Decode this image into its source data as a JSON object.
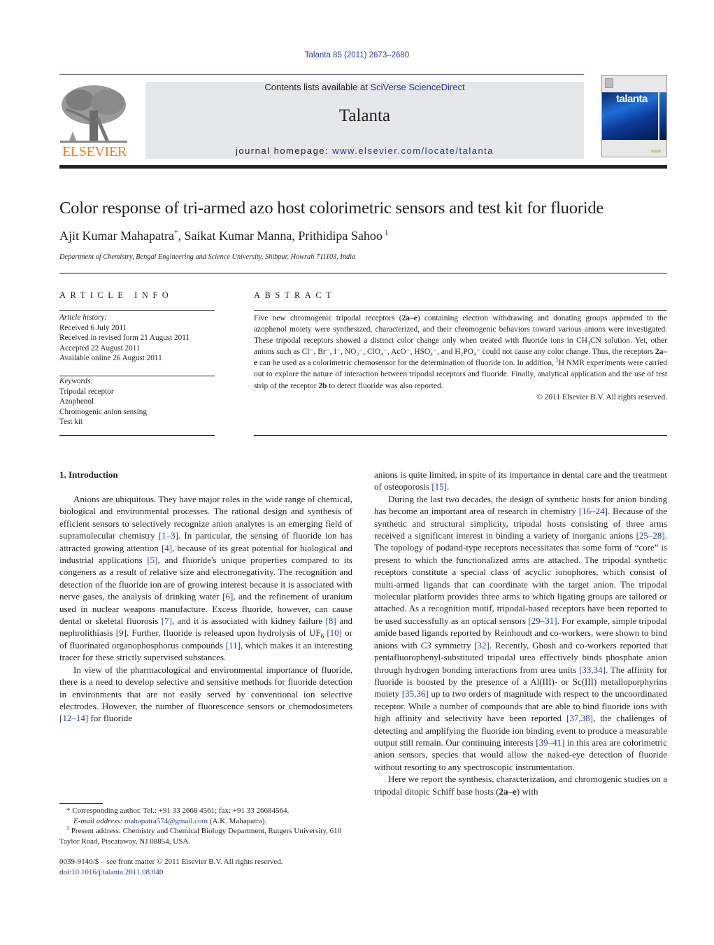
{
  "header": {
    "citation": "Talanta 85 (2011) 2673–2680",
    "contents_prefix": "Contents lists available at ",
    "contents_link": "SciVerse ScienceDirect",
    "journal_name": "Talanta",
    "homepage_prefix": "journal homepage: ",
    "homepage_link": "www.elsevier.com/locate/talanta",
    "publisher_logo_text": "ELSEVIER",
    "cover_title": "talanta",
    "colors": {
      "link": "#2b3990",
      "publisher_orange": "#f07f1e",
      "header_box": "#e6e7e8"
    }
  },
  "article": {
    "title": "Color response of tri-armed azo host colorimetric sensors and test kit for fluoride",
    "authors": [
      {
        "name": "Ajit Kumar Mahapatra",
        "mark": "*"
      },
      {
        "name": "Saikat Kumar Manna",
        "mark": ""
      },
      {
        "name": "Prithidipa Sahoo",
        "mark": "1"
      }
    ],
    "affiliation": "Department of Chemistry, Bengal Engineering and Science University, Shibpur, Howrah 711103, India"
  },
  "article_info": {
    "heading": "ARTICLE INFO",
    "history_label": "Article history:",
    "history": [
      "Received 6 July 2011",
      "Received in revised form 21 August 2011",
      "Accepted 22 August 2011",
      "Available online 26 August 2011"
    ],
    "keywords_label": "Keywords:",
    "keywords": [
      "Tripodal receptor",
      "Azophenol",
      "Chromogenic anion sensing",
      "Test kit"
    ]
  },
  "abstract": {
    "heading": "ABSTRACT",
    "p1": "Five new chromogenic tripodal receptors (",
    "b1": "2a–e",
    "p2": ") containing electron withdrawing and donating groups appended to the azophenol moiety were synthesized, characterized, and their chromogenic behaviors toward various anions were investigated. These tripodal receptors showed a distinct color change only when treated with fluoride ions in CH",
    "p3": "CN solution. Yet, other anions such as Cl⁻, Br⁻, I⁻, NO₃⁻, ClO₄⁻, AcO⁻, HSO₄⁻, and H₂PO₄⁻ could not cause any color change. Thus, the receptors ",
    "b2": "2a–e",
    "p4": " can be used as a colorimetric chemosensor for the determination of fluoride ion. In addition, ",
    "p5": "H NMR experiments were carried out to explore the nature of interaction between tripodal receptors and fluoride. Finally, analytical application and the use of test strip of the receptor ",
    "b3": "2b",
    "p6": " to detect fluoride was also reported.",
    "copyright": "© 2011 Elsevier B.V. All rights reserved."
  },
  "introduction": {
    "heading": "1.  Introduction",
    "left": {
      "p1_a": "Anions are ubiquitous. They have major roles in the wide range of chemical, biological and environmental processes. The rational design and synthesis of efficient sensors to selectively recognize anion analytes is an emerging field of supramolecular chemistry ",
      "c1": "[1–3]",
      "p1_b": ". In particular, the sensing of fluoride ion has attracted growing attention ",
      "c2": "[4]",
      "p1_c": ", because of its great potential for biological and industrial applications ",
      "c3": "[5]",
      "p1_d": ", and fluoride's unique properties compared to its congeners as a result of relative size and electronegativity. The recognition and detection of the fluoride ion are of growing interest because it is associated with nerve gases, the analysis of drinking water ",
      "c4": "[6]",
      "p1_e": ", and the refinement of uranium used in nuclear weapons manufacture. Excess fluoride, however, can cause dental or skeletal fluorosis ",
      "c5": "[7]",
      "p1_f": ", and it is associated with kidney failure ",
      "c6": "[8]",
      "p1_g": " and nephrolithiasis ",
      "c7": "[9]",
      "p1_h": ". Further, fluoride is released upon hydrolysis of UF",
      "p1_h_sub": "6",
      "c8": "[10]",
      "p1_i": " or of fluorinated organophosphorus compounds ",
      "c9": "[11]",
      "p1_j": ", which makes it an interesting tracer for these strictly supervised substances.",
      "p2_a": "In view of the pharmacological and environmental importance of fluoride, there is a need to develop selective and sensitive methods for fluoride detection in environments that are not easily served by conventional ion selective electrodes. However, the number of fluorescence sensors or chemodosimeters ",
      "c10": "[12–14]",
      "p2_b": " for fluoride"
    },
    "right": {
      "p0_a": "anions is quite limited, in spite of its importance in dental care and the treatment of osteoporosis ",
      "c1": "[15]",
      "p0_b": ".",
      "p1_a": "During the last two decades, the design of synthetic hosts for anion binding has become an important area of research in chemistry ",
      "c2": "[16–24]",
      "p1_b": ". Because of the synthetic and structural simplicity, tripodal hosts consisting of three arms received a significant interest in binding a variety of inorganic anions ",
      "c3": "[25–28]",
      "p1_c": ". The topology of podand-type receptors necessitates that some form of “core” is present to which the functionalized arms are attached. The tripodal synthetic receptors constitute a special class of acyclic ionophores, which consist of multi-armed ligands that can coordinate with the target anion. The tripodal molecular platform provides three arms to which ligating groups are tailored or attached. As a recognition motif, tripodal-based receptors have been reported to be used successfully as an optical sensors ",
      "c4": "[29–31]",
      "p1_d": ". For example, simple tripodal amide based ligands reported by Reinhoudt and co-workers, were shown to bind anions with ",
      "p1_d_ital": "C3",
      "p1_e": " symmetry ",
      "c5": "[32]",
      "p1_f": ". Recently, Ghosh and co-workers reported that pentafluorophenyl-substituted tripodal urea effectively binds phosphate anion through hydrogen bonding interactions from urea units ",
      "c6": "[33,34]",
      "p1_g": ". The affinity for fluoride is boosted by the presence of a Al(III)- or Sc(III) metalloporphyrins moiety ",
      "c7": "[35,36]",
      "p1_h": " up to two orders of magnitude with respect to the uncoordinated receptor. While a number of compounds that are able to bind fluoride ions with high affinity and selectivity have been reported ",
      "c8": "[37,38]",
      "p1_i": ", the challenges of detecting and amplifying the fluoride ion binding event to produce a measurable output still remain. Our continuing interests ",
      "c9": "[39–41]",
      "p1_j": " in this area are colorimetric anion sensors, species that would allow the naked-eye detection of fluoride without resorting to any spectroscopic instrumentation.",
      "p2_a": "Here we report the synthesis, characterization, and chromogenic studies on a tripodal ditopic Schiff base hosts (",
      "p2_b": "2a–e",
      "p2_c": ") with"
    }
  },
  "footnotes": {
    "corresponding": "* Corresponding author. Tel.: +91 33 2668 4561; fax: +91 33 26684564.",
    "email_label": "E-mail address: ",
    "email": "mahapatra574@gmail.com",
    "email_suffix": " (A.K. Mahapatra).",
    "present_mark": "1",
    "present": " Present address: Chemistry and Chemical Biology Department, Rutgers University, 610 Taylor Road, Piscataway, NJ 08854, USA."
  },
  "front_matter": {
    "issn": "0039-9140/$ – see front matter © 2011 Elsevier B.V. All rights reserved.",
    "doi_prefix": "doi:",
    "doi": "10.1016/j.talanta.2011.08.040"
  }
}
